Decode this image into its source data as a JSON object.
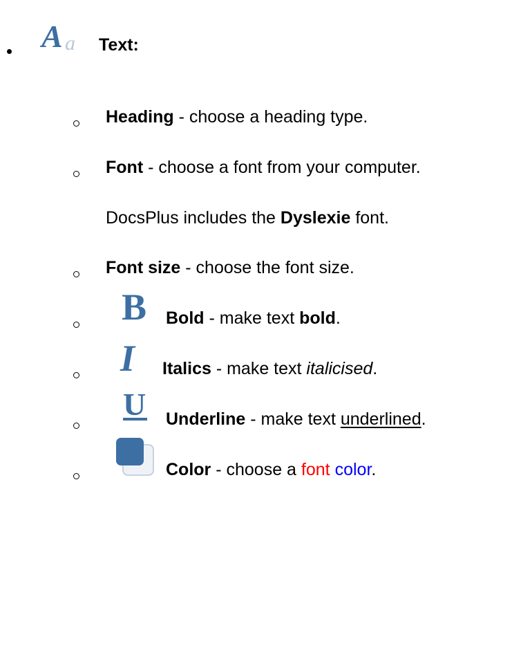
{
  "text_section": {
    "label": "Text:",
    "icon": "text-font-icon"
  },
  "items": {
    "heading": {
      "term": "Heading",
      "desc": " - choose a heading type."
    },
    "font": {
      "term": "Font",
      "desc": " - choose a font from your computer."
    },
    "font_note": {
      "prefix": "DocsPlus includes the ",
      "term": "Dyslexie",
      "suffix": " font."
    },
    "font_size": {
      "term": "Font size",
      "desc": " - choose the font size."
    },
    "bold": {
      "icon": "bold-icon",
      "term": "Bold",
      "desc": " - make text ",
      "example": "bold",
      "end": "."
    },
    "italics": {
      "icon": "italic-icon",
      "term": "Italics",
      "desc": " - make text ",
      "example": "italicised",
      "end": "."
    },
    "underline": {
      "icon": "underline-icon",
      "term": "Underline",
      "desc": " - make text ",
      "example": "underlined",
      "end": "."
    },
    "color": {
      "icon": "color-swatch-icon",
      "term": "Color",
      "desc": " - choose a ",
      "word1": "font",
      "word2": "color",
      "end": "."
    }
  },
  "colors": {
    "icon_blue": "#3d6fa3",
    "red_word": "#ff0000",
    "blue_word": "#0000ff"
  }
}
